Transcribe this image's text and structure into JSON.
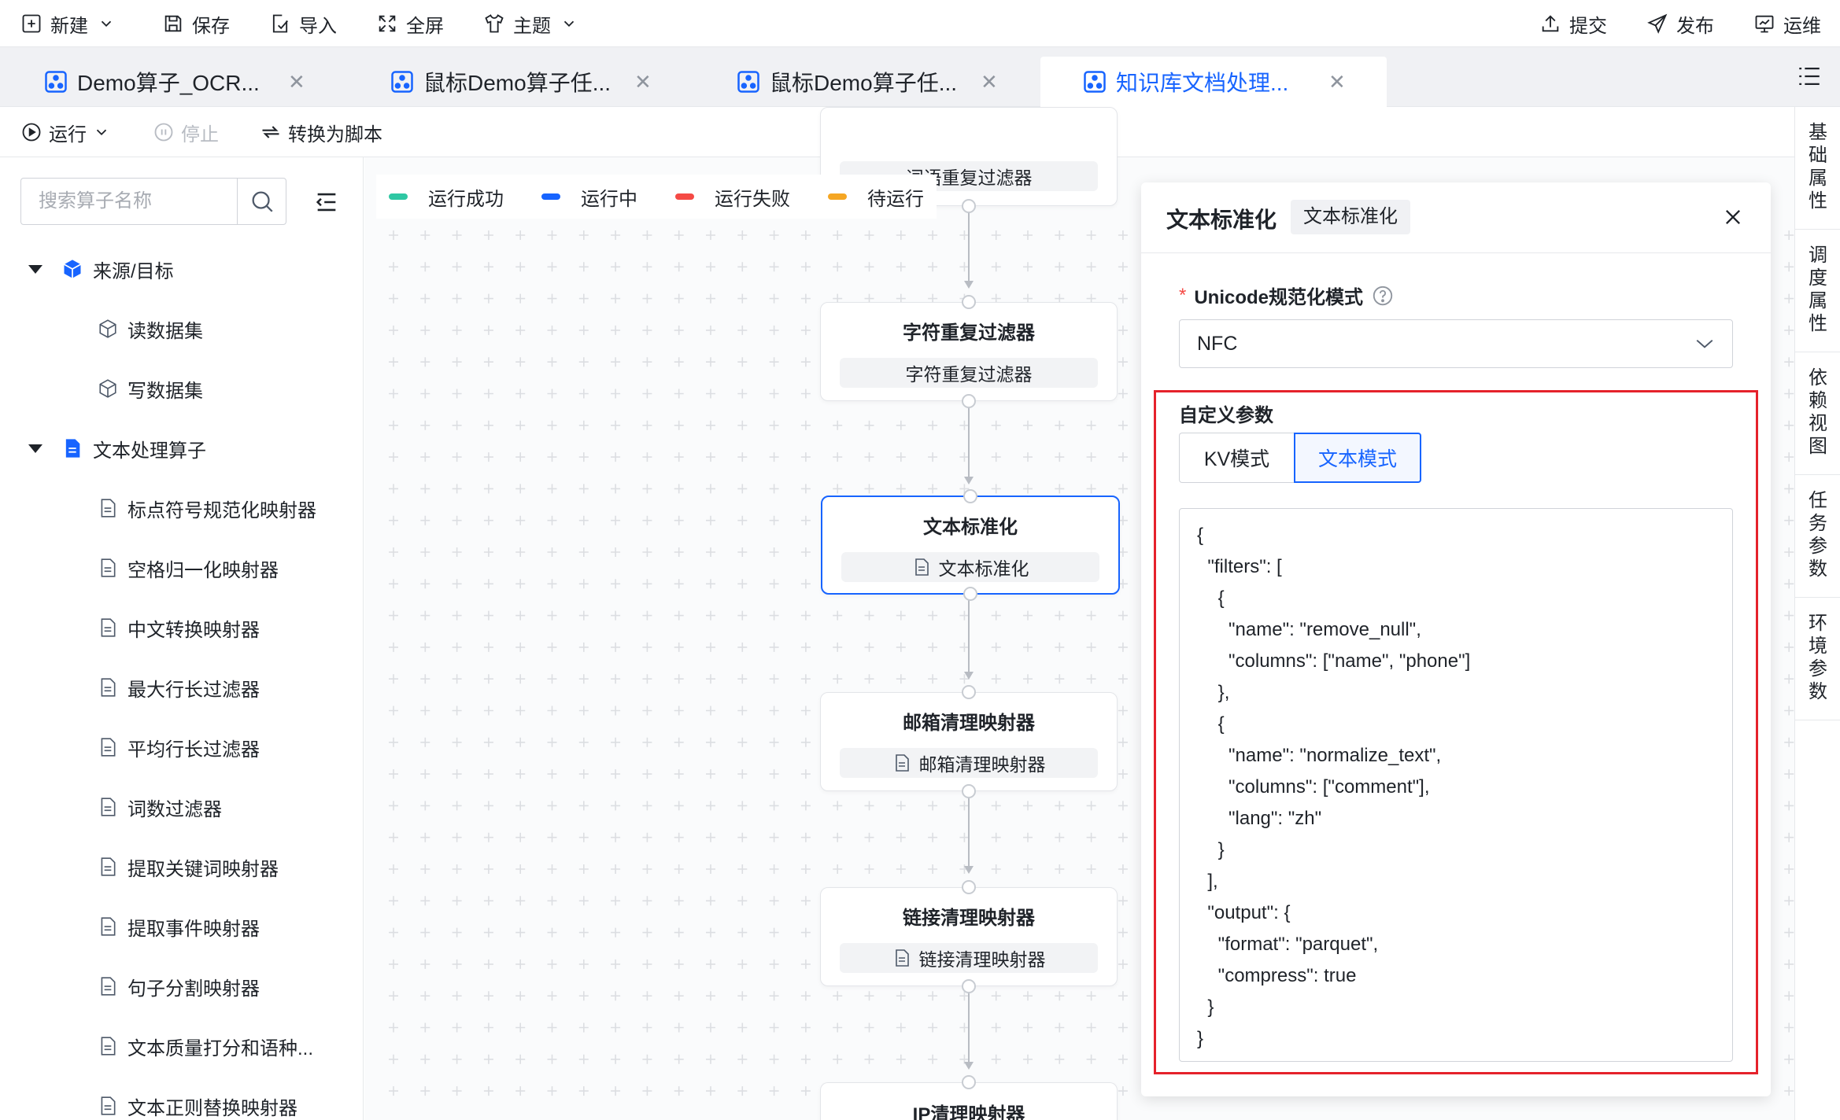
{
  "toolbar": {
    "new_label": "新建",
    "save_label": "保存",
    "import_label": "导入",
    "fullscreen_label": "全屏",
    "theme_label": "主题",
    "submit_label": "提交",
    "publish_label": "发布",
    "ops_label": "运维"
  },
  "tabs": [
    {
      "label": "Demo算子_OCR...",
      "active": false
    },
    {
      "label": "鼠标Demo算子任...",
      "active": false
    },
    {
      "label": "鼠标Demo算子任...",
      "active": false
    },
    {
      "label": "知识库文档处理...",
      "active": true
    }
  ],
  "runbar": {
    "run_label": "运行",
    "stop_label": "停止",
    "convert_label": "转换为脚本"
  },
  "sidebar": {
    "search_placeholder": "搜索算子名称",
    "groups": [
      {
        "label": "来源/目标",
        "items": [
          "读数据集",
          "写数据集"
        ]
      },
      {
        "label": "文本处理算子",
        "items": [
          "标点符号规范化映射器",
          "空格归一化映射器",
          "中文转换映射器",
          "最大行长过滤器",
          "平均行长过滤器",
          "词数过滤器",
          "提取关键词映射器",
          "提取事件映射器",
          "句子分割映射器",
          "文本质量打分和语种...",
          "文本正则替换映射器"
        ]
      }
    ]
  },
  "legend": {
    "success": "运行成功",
    "running": "运行中",
    "failed": "运行失败",
    "pending": "待运行",
    "colors": {
      "success": "#2ec7a3",
      "running": "#1764ff",
      "failed": "#f54a45",
      "pending": "#f5a623"
    }
  },
  "nodes": [
    {
      "title": "",
      "sub": "词语重复过滤器"
    },
    {
      "title": "字符重复过滤器",
      "sub": "字符重复过滤器"
    },
    {
      "title": "文本标准化",
      "sub": "文本标准化"
    },
    {
      "title": "邮箱清理映射器",
      "sub": "邮箱清理映射器"
    },
    {
      "title": "链接清理映射器",
      "sub": "链接清理映射器"
    },
    {
      "title": "IP清理映射器",
      "sub": ""
    }
  ],
  "panel": {
    "title": "文本标准化",
    "tag": "文本标准化",
    "field_label": "Unicode规范化模式",
    "field_value": "NFC",
    "custom_label": "自定义参数",
    "mode_kv": "KV模式",
    "mode_text": "文本模式",
    "code": "{\n  \"filters\": [\n    {\n      \"name\": \"remove_null\",\n      \"columns\": [\"name\", \"phone\"]\n    },\n    {\n      \"name\": \"normalize_text\",\n      \"columns\": [\"comment\"],\n      \"lang\": \"zh\"\n    }\n  ],\n  \"output\": {\n    \"format\": \"parquet\",\n    \"compress\": true\n  }\n}"
  },
  "right_tabs": [
    "基础属性",
    "调度属性",
    "依赖视图",
    "任务参数",
    "环境参数"
  ]
}
